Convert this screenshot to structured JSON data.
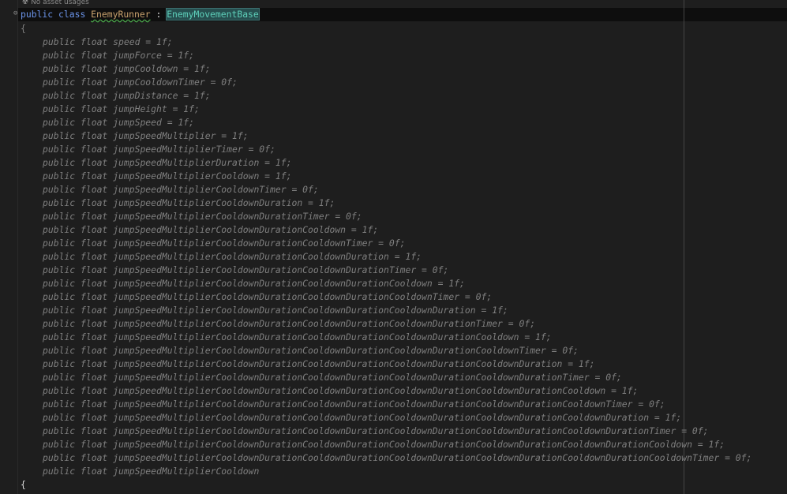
{
  "editor": {
    "usages_hint": "No asset usages",
    "class_decl": {
      "public": "public",
      "class": "class",
      "name": "EnemyRunner",
      "colon": " : ",
      "base": "EnemyMovementBase"
    },
    "open_brace": "{",
    "close_brace": "{",
    "fields": [
      "public float speed = 1f;",
      "public float jumpForce = 1f;",
      "public float jumpCooldown = 1f;",
      "public float jumpCooldownTimer = 0f;",
      "public float jumpDistance = 1f;",
      "public float jumpHeight = 1f;",
      "public float jumpSpeed = 1f;",
      "public float jumpSpeedMultiplier = 1f;",
      "public float jumpSpeedMultiplierTimer = 0f;",
      "public float jumpSpeedMultiplierDuration = 1f;",
      "public float jumpSpeedMultiplierCooldown = 1f;",
      "public float jumpSpeedMultiplierCooldownTimer = 0f;",
      "public float jumpSpeedMultiplierCooldownDuration = 1f;",
      "public float jumpSpeedMultiplierCooldownDurationTimer = 0f;",
      "public float jumpSpeedMultiplierCooldownDurationCooldown = 1f;",
      "public float jumpSpeedMultiplierCooldownDurationCooldownTimer = 0f;",
      "public float jumpSpeedMultiplierCooldownDurationCooldownDuration = 1f;",
      "public float jumpSpeedMultiplierCooldownDurationCooldownDurationTimer = 0f;",
      "public float jumpSpeedMultiplierCooldownDurationCooldownDurationCooldown = 1f;",
      "public float jumpSpeedMultiplierCooldownDurationCooldownDurationCooldownTimer = 0f;",
      "public float jumpSpeedMultiplierCooldownDurationCooldownDurationCooldownDuration = 1f;",
      "public float jumpSpeedMultiplierCooldownDurationCooldownDurationCooldownDurationTimer = 0f;",
      "public float jumpSpeedMultiplierCooldownDurationCooldownDurationCooldownDurationCooldown = 1f;",
      "public float jumpSpeedMultiplierCooldownDurationCooldownDurationCooldownDurationCooldownTimer = 0f;",
      "public float jumpSpeedMultiplierCooldownDurationCooldownDurationCooldownDurationCooldownDuration = 1f;",
      "public float jumpSpeedMultiplierCooldownDurationCooldownDurationCooldownDurationCooldownDurationTimer = 0f;",
      "public float jumpSpeedMultiplierCooldownDurationCooldownDurationCooldownDurationCooldownDurationCooldown = 1f;",
      "public float jumpSpeedMultiplierCooldownDurationCooldownDurationCooldownDurationCooldownDurationCooldownTimer = 0f;",
      "public float jumpSpeedMultiplierCooldownDurationCooldownDurationCooldownDurationCooldownDurationCooldownDuration = 1f;",
      "public float jumpSpeedMultiplierCooldownDurationCooldownDurationCooldownDurationCooldownDurationCooldownDurationTimer = 0f;",
      "public float jumpSpeedMultiplierCooldownDurationCooldownDurationCooldownDurationCooldownDurationCooldownDurationCooldown = 1f;",
      "public float jumpSpeedMultiplierCooldownDurationCooldownDurationCooldownDurationCooldownDurationCooldownDurationCooldownTimer = 0f;",
      "public float jumpSpeedMultiplierCooldown"
    ],
    "icons": {
      "usages": "unity-asset-icon",
      "fold": "fold-collapse-icon"
    },
    "colors": {
      "background": "#1e1e1e",
      "keyword": "#6c95eb",
      "class_name": "#c9a26d",
      "base_class": "#5ed0ba",
      "dimmed_member": "#7f7f7f"
    }
  }
}
